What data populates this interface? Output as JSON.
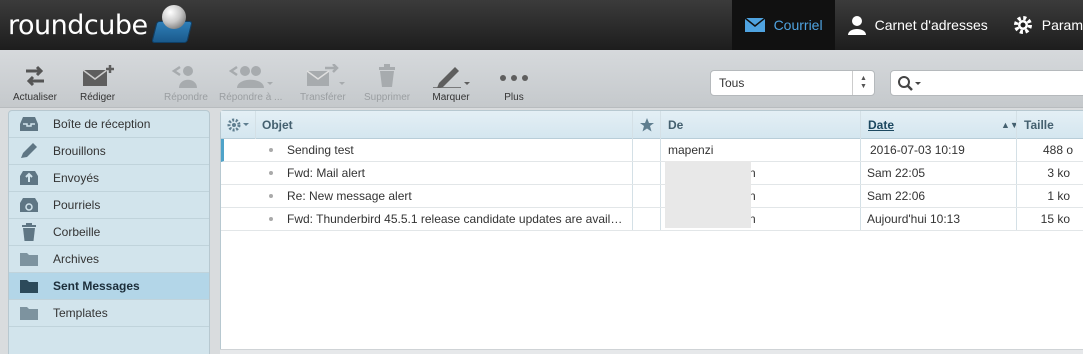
{
  "header": {
    "logo_text": "roundcube",
    "nav": [
      {
        "label": "Courriel",
        "icon": "envelope-icon",
        "active": true
      },
      {
        "label": "Carnet d'adresses",
        "icon": "contact-icon",
        "active": false
      },
      {
        "label": "Param",
        "icon": "gear-icon",
        "active": false
      }
    ]
  },
  "toolbar": {
    "refresh": "Actualiser",
    "compose": "Rédiger",
    "reply": "Répondre",
    "reply_all": "Répondre à ...",
    "forward": "Transférer",
    "delete": "Supprimer",
    "mark": "Marquer",
    "more": "Plus",
    "filter_value": "Tous"
  },
  "folders": [
    {
      "label": "Boîte de réception",
      "icon": "inbox-icon",
      "selected": false
    },
    {
      "label": "Brouillons",
      "icon": "pencil-icon",
      "selected": false
    },
    {
      "label": "Envoyés",
      "icon": "sent-icon",
      "selected": false
    },
    {
      "label": "Pourriels",
      "icon": "junk-icon",
      "selected": false
    },
    {
      "label": "Corbeille",
      "icon": "trash-icon",
      "selected": false
    },
    {
      "label": "Archives",
      "icon": "folder-icon",
      "selected": false
    },
    {
      "label": "Sent Messages",
      "icon": "folder-icon",
      "selected": true
    },
    {
      "label": "Templates",
      "icon": "folder-icon",
      "selected": false
    }
  ],
  "list": {
    "columns": {
      "subject": "Objet",
      "from": "De",
      "date": "Date",
      "size": "Taille"
    },
    "rows": [
      {
        "subject": "Sending test",
        "from": "mapenzi",
        "date": "2016-07-03 10:19",
        "size": "488 o"
      },
      {
        "subject": "Fwd: Mail alert",
        "from": "n",
        "date": "Sam 22:05",
        "size": "3 ko"
      },
      {
        "subject": "Re: New message alert",
        "from": "n",
        "date": "Sam 22:06",
        "size": "1 ko"
      },
      {
        "subject": "Fwd: Thunderbird 45.5.1 release candidate updates are avail…",
        "from": "n",
        "date": "Aujourd'hui 10:13",
        "size": "15 ko"
      }
    ]
  },
  "colors": {
    "accent": "#4fa3e0",
    "header_bg": "#1d1d1d",
    "sidebar_bg": "#d2e4ec",
    "selected_folder": "#b3d6e8"
  }
}
